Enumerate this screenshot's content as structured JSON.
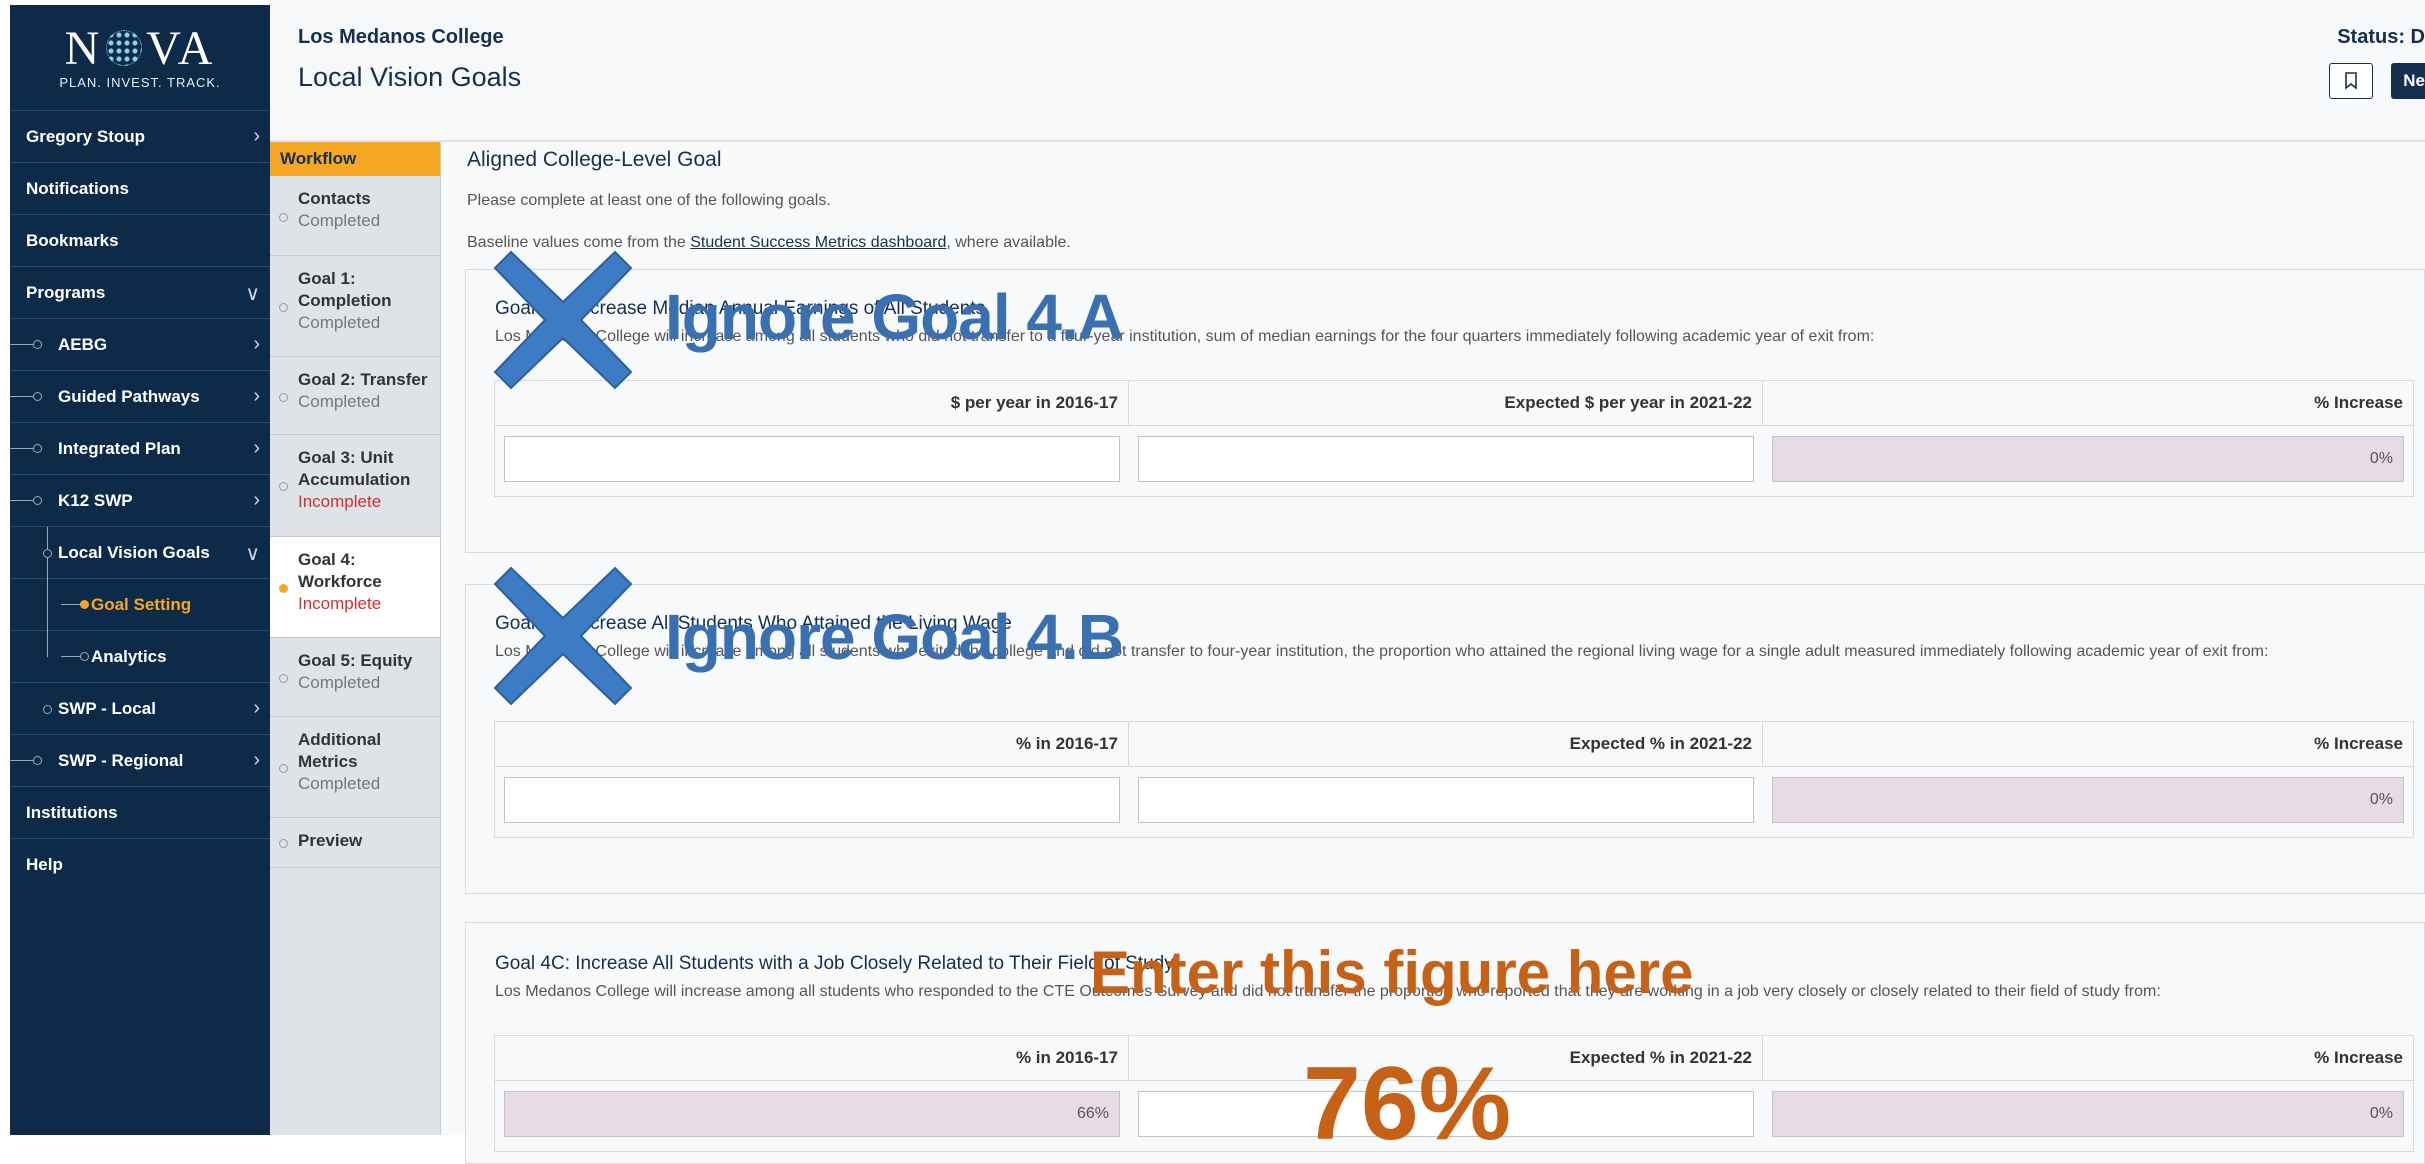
{
  "brand": {
    "logo_text": "NOVA",
    "tagline": "PLAN. INVEST. TRACK."
  },
  "sidebar": {
    "items": [
      {
        "label": "Gregory Stoup",
        "chevron": ">"
      },
      {
        "label": "Notifications"
      },
      {
        "label": "Bookmarks"
      },
      {
        "label": "Programs",
        "chevron": "v"
      },
      {
        "label": "AEBG",
        "chevron": ">"
      },
      {
        "label": "Guided Pathways",
        "chevron": ">"
      },
      {
        "label": "Integrated Plan",
        "chevron": ">"
      },
      {
        "label": "K12 SWP",
        "chevron": ">"
      },
      {
        "label": "Local Vision Goals",
        "chevron": "v"
      },
      {
        "label": "Goal Setting"
      },
      {
        "label": "Analytics"
      },
      {
        "label": "SWP - Local",
        "chevron": ">"
      },
      {
        "label": "SWP - Regional",
        "chevron": ">"
      },
      {
        "label": "Institutions"
      },
      {
        "label": "Help"
      }
    ]
  },
  "header": {
    "org": "Los Medanos College",
    "title": "Local Vision Goals",
    "status": "Status: D",
    "next_button": "Ne"
  },
  "workflow": {
    "heading": "Workflow",
    "steps": [
      {
        "title": "Contacts",
        "status": "Completed"
      },
      {
        "title": "Goal 1: Completion",
        "status": "Completed"
      },
      {
        "title": "Goal 2: Transfer",
        "status": "Completed"
      },
      {
        "title": "Goal 3: Unit Accumulation",
        "status": "Incomplete"
      },
      {
        "title": "Goal 4: Workforce",
        "status": "Incomplete"
      },
      {
        "title": "Goal 5: Equity",
        "status": "Completed"
      },
      {
        "title": "Additional Metrics",
        "status": "Completed"
      },
      {
        "title": "Preview",
        "status": ""
      }
    ]
  },
  "main": {
    "section_title": "Aligned College-Level Goal",
    "instruction": "Please complete at least one of the following goals.",
    "baseline_prefix": "Baseline values come from the ",
    "baseline_link": "Student Success Metrics dashboard",
    "baseline_suffix": ", where available.",
    "goals": [
      {
        "title": "Goal 4A: Increase Median Annual Earnings of All Students",
        "description": "Los Medanos College will increase among all students who did not transfer to a four-year institution, sum of median earnings for the four quarters immediately following academic year of exit from:",
        "columns": [
          "$ per year in 2016-17",
          "Expected $ per year in 2021-22",
          "% Increase"
        ],
        "values": [
          "",
          "",
          "0%"
        ]
      },
      {
        "title": "Goal 4B: Increase All Students Who Attained the Living Wage",
        "description": "Los Medanos College will increase among all students who exited the college and did not transfer to four-year institution, the proportion who attained the regional living wage for a single adult measured immediately following academic year of exit from:",
        "columns": [
          "% in 2016-17",
          "Expected % in 2021-22",
          "% Increase"
        ],
        "values": [
          "",
          "",
          "0%"
        ]
      },
      {
        "title": "Goal 4C: Increase All Students with a Job Closely Related to Their Field of Study",
        "description": "Los Medanos College will increase among all students who responded to the CTE Outcomes Survey and did not transfer the proportion who reported that they are working in a job very closely or closely related to their field of study from:",
        "columns": [
          "% in 2016-17",
          "Expected % in 2021-22",
          "% Increase"
        ],
        "values": [
          "66%",
          "",
          "0%"
        ]
      }
    ]
  },
  "annotations": {
    "ignore_a": "Ignore Goal 4.A",
    "ignore_b": "Ignore Goal 4.B",
    "enter": "Enter this figure here",
    "value": "76%",
    "x_color": "#3d7cc4",
    "ignore_color": "#3a6fb0",
    "enter_color": "#c56217"
  }
}
